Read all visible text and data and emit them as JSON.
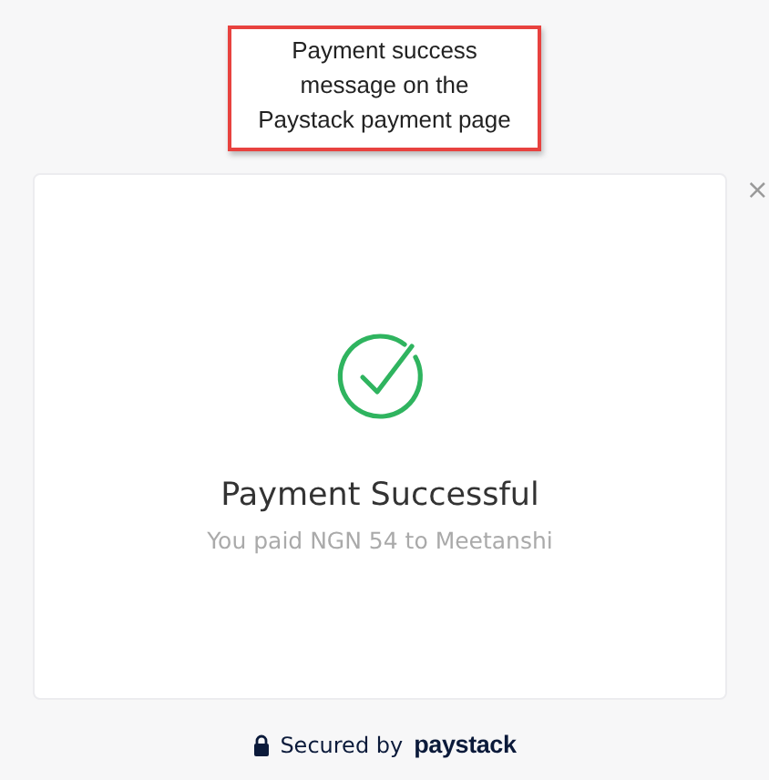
{
  "annotation": {
    "text": "Payment success message on the Paystack payment page"
  },
  "close": {
    "symbol": "×"
  },
  "result": {
    "success": true,
    "title": "Payment Successful",
    "message": "You paid NGN 54 to Meetanshi"
  },
  "footer": {
    "text": "Secured by",
    "brand": "paystack"
  }
}
